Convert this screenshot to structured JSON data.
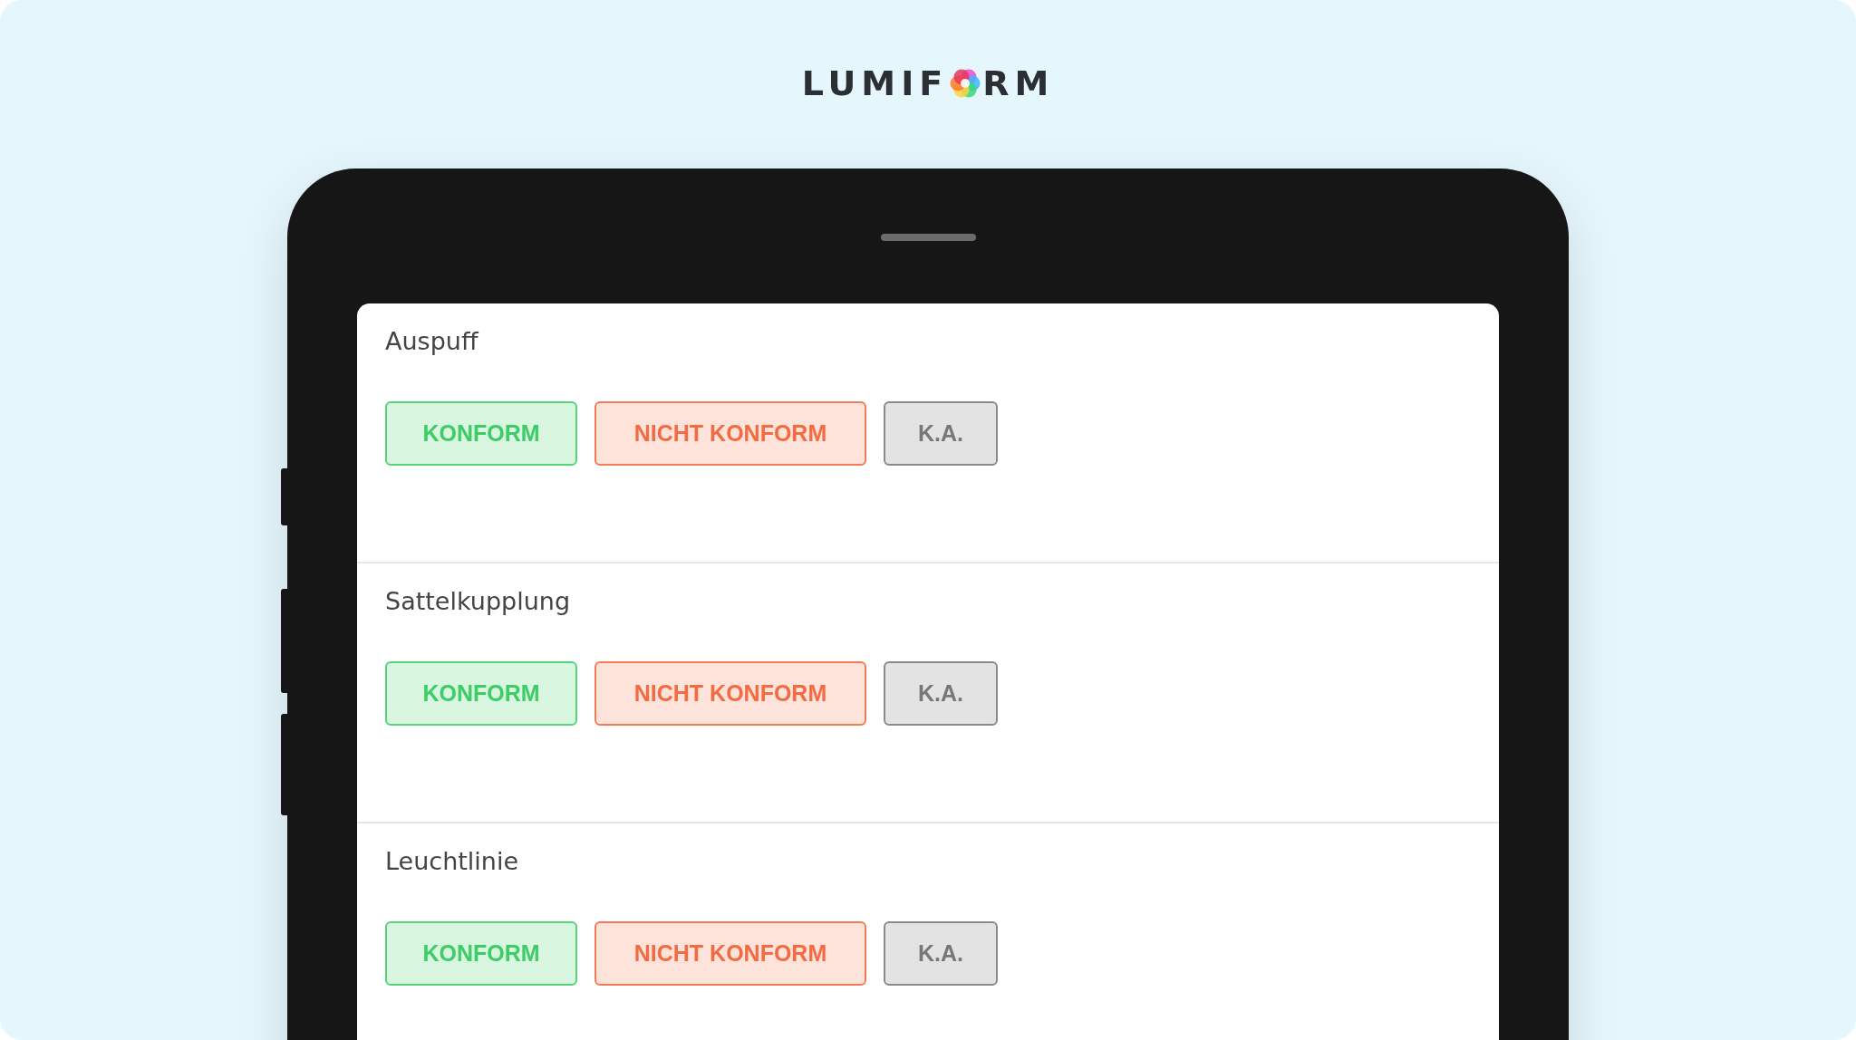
{
  "logo": {
    "before": "LUMIF",
    "after": "RM"
  },
  "sections": [
    {
      "label": "Auspuff",
      "options": [
        {
          "kind": "conform",
          "label": "KONFORM"
        },
        {
          "kind": "nonconform",
          "label": "NICHT KONFORM"
        },
        {
          "kind": "na",
          "label": "K.A."
        }
      ]
    },
    {
      "label": "Sattelkupplung",
      "options": [
        {
          "kind": "conform",
          "label": "KONFORM"
        },
        {
          "kind": "nonconform",
          "label": "NICHT KONFORM"
        },
        {
          "kind": "na",
          "label": "K.A."
        }
      ]
    },
    {
      "label": "Leuchtlinie",
      "options": [
        {
          "kind": "conform",
          "label": "KONFORM"
        },
        {
          "kind": "nonconform",
          "label": "NICHT KONFORM"
        },
        {
          "kind": "na",
          "label": "K.A."
        }
      ]
    }
  ]
}
